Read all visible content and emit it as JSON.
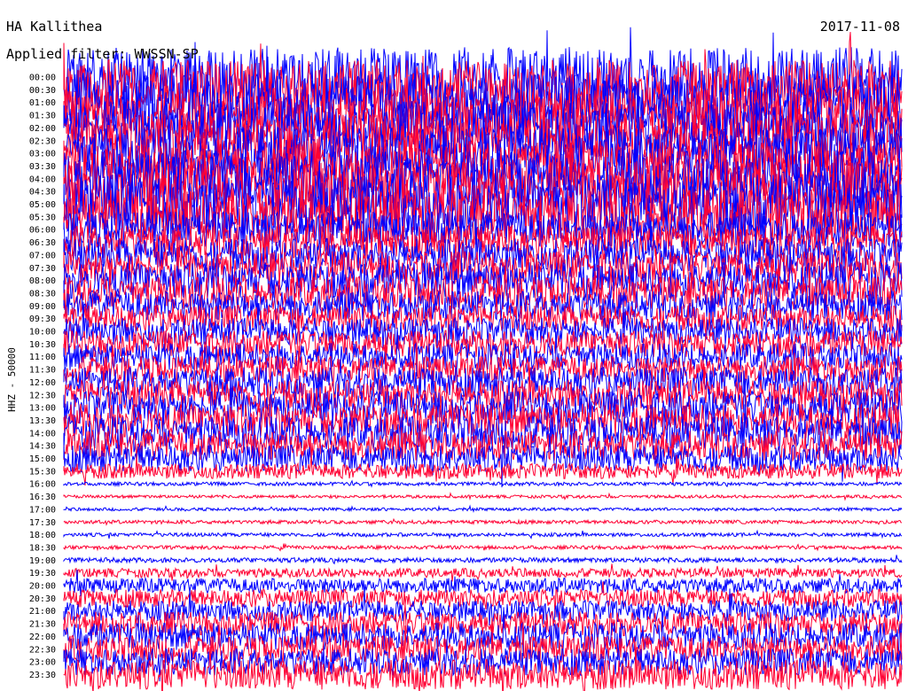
{
  "header": {
    "station": "HA Kallithea",
    "date": "2017-11-08",
    "filter": "Applied filter: WWSSN-SP"
  },
  "y_axis_label": "HHZ - 50000",
  "colors": {
    "trace_a": "#0000ff",
    "trace_b": "#ff0033",
    "background": "#ffffff"
  },
  "chart_data": {
    "type": "line",
    "description_type": "helicorder",
    "row_labels": [
      "00:00",
      "00:30",
      "01:00",
      "01:30",
      "02:00",
      "02:30",
      "03:00",
      "03:30",
      "04:00",
      "04:30",
      "05:00",
      "05:30",
      "06:00",
      "06:30",
      "07:00",
      "07:30",
      "08:00",
      "08:30",
      "09:00",
      "09:30",
      "10:00",
      "10:30",
      "11:00",
      "11:30",
      "12:00",
      "12:30",
      "13:00",
      "13:30",
      "14:00",
      "14:30",
      "15:00",
      "15:30",
      "16:00",
      "16:30",
      "17:00",
      "17:30",
      "18:00",
      "18:30",
      "19:00",
      "19:30",
      "20:00",
      "20:30",
      "21:00",
      "21:30",
      "22:00",
      "22:30",
      "23:00",
      "23:30"
    ],
    "row_amplitude": [
      1.0,
      1.0,
      0.95,
      0.9,
      0.9,
      0.9,
      0.85,
      0.85,
      0.95,
      1.0,
      1.0,
      0.9,
      0.6,
      0.55,
      0.55,
      0.55,
      0.6,
      0.55,
      0.5,
      0.45,
      0.45,
      0.45,
      0.45,
      0.45,
      0.5,
      0.5,
      0.55,
      0.55,
      0.55,
      0.5,
      0.45,
      0.25,
      0.06,
      0.05,
      0.05,
      0.06,
      0.06,
      0.06,
      0.08,
      0.15,
      0.25,
      0.3,
      0.35,
      0.4,
      0.45,
      0.45,
      0.45,
      0.5
    ],
    "trace_colors_alternate": [
      "blue",
      "red"
    ],
    "grid": false
  }
}
